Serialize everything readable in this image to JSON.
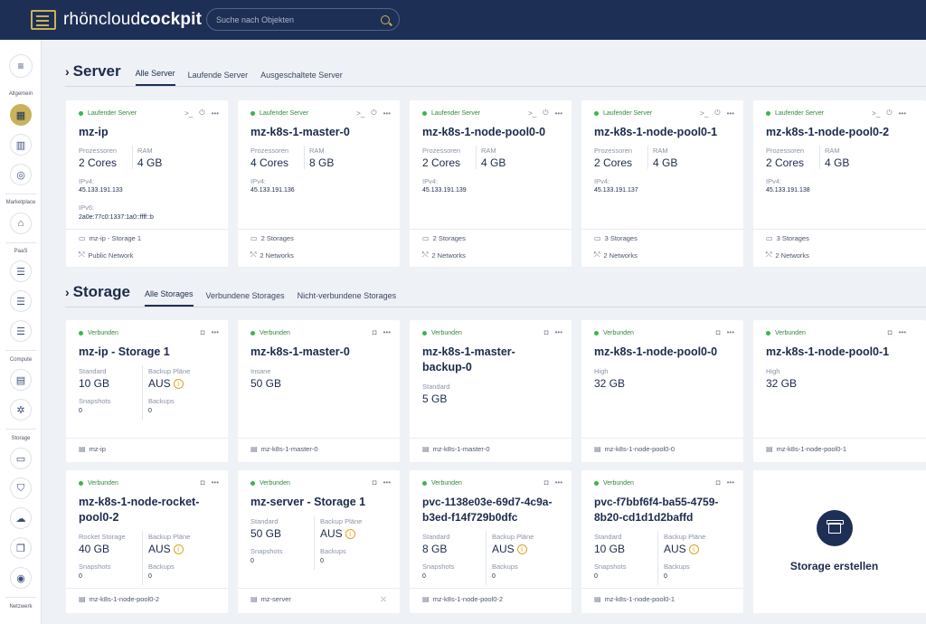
{
  "brand": {
    "name_light": "rhöncloud",
    "name_bold": "cockpit"
  },
  "search": {
    "placeholder": "Suche nach Objekten"
  },
  "sidebar": {
    "sections": [
      "Allgemein",
      "Marketplace",
      "PaaS",
      "Compute",
      "Storage",
      "Netzwerk"
    ],
    "icons": [
      "menu-icon",
      "dashboard-icon",
      "chart-icon",
      "location-icon",
      "marketplace-icon",
      "database-icon",
      "database-icon",
      "database-icon",
      "server-icon",
      "kubernetes-icon",
      "storage-icon",
      "shield-icon",
      "cloud-icon",
      "files-icon",
      "disk-icon"
    ]
  },
  "server_section": {
    "title": "Server",
    "tabs": [
      "Alle Server",
      "Laufende Server",
      "Ausgeschaltete Server"
    ],
    "active_tab": 0,
    "labels": {
      "cpu": "Prozessoren",
      "ram": "RAM",
      "ipv4": "IPv4:",
      "ipv6": "IPv6:"
    },
    "cards": [
      {
        "status": "Laufender Server",
        "name": "mz-ip",
        "cpu": "2 Cores",
        "ram": "4 GB",
        "ipv4": "45.133.191.133",
        "ipv6": "2a0e:77c0:1337:1a0::ffff::b",
        "storage": "mz-ip - Storage 1",
        "network": "Public Network"
      },
      {
        "status": "Laufender Server",
        "name": "mz-k8s-1-master-0",
        "cpu": "4 Cores",
        "ram": "8 GB",
        "ipv4": "45.133.191.136",
        "storage": "2 Storages",
        "network": "2 Networks"
      },
      {
        "status": "Laufender Server",
        "name": "mz-k8s-1-node-pool0-0",
        "cpu": "2 Cores",
        "ram": "4 GB",
        "ipv4": "45.133.191.139",
        "storage": "2 Storages",
        "network": "2 Networks"
      },
      {
        "status": "Laufender Server",
        "name": "mz-k8s-1-node-pool0-1",
        "cpu": "2 Cores",
        "ram": "4 GB",
        "ipv4": "45.133.191.137",
        "storage": "3 Storages",
        "network": "2 Networks"
      },
      {
        "status": "Laufender Server",
        "name": "mz-k8s-1-node-pool0-2",
        "cpu": "2 Cores",
        "ram": "4 GB",
        "ipv4": "45.133.191.138",
        "storage": "3 Storages",
        "network": "2 Networks"
      }
    ]
  },
  "storage_section": {
    "title": "Storage",
    "tabs": [
      "Alle Storages",
      "Verbundene Storages",
      "Nicht-verbundene Storages"
    ],
    "active_tab": 0,
    "labels": {
      "backup": "Backup Pläne",
      "snapshots": "Snapshots",
      "backups": "Backups"
    },
    "cards": [
      {
        "status": "Verbunden",
        "name": "mz-ip - Storage 1",
        "type": "Standard",
        "size": "10 GB",
        "backup_plan": "AUS",
        "snapshots": "0",
        "backups": "0",
        "server": "mz-ip"
      },
      {
        "status": "Verbunden",
        "name": "mz-k8s-1-master-0",
        "type": "Insane",
        "size": "50 GB",
        "server": "mz-k8s-1-master-0"
      },
      {
        "status": "Verbunden",
        "name": "mz-k8s-1-master-backup-0",
        "type": "Standard",
        "size": "5 GB",
        "server": "mz-k8s-1-master-0"
      },
      {
        "status": "Verbunden",
        "name": "mz-k8s-1-node-pool0-0",
        "type": "High",
        "size": "32 GB",
        "server": "mz-k8s-1-node-pool0-0"
      },
      {
        "status": "Verbunden",
        "name": "mz-k8s-1-node-pool0-1",
        "type": "High",
        "size": "32 GB",
        "server": "mz-k8s-1-node-pool0-1"
      },
      {
        "status": "Verbunden",
        "name": "mz-k8s-1-node-rocket-pool0-2",
        "type": "Rocket Storage",
        "size": "40 GB",
        "backup_plan": "AUS",
        "snapshots": "0",
        "backups": "0",
        "server": "mz-k8s-1-node-pool0-2"
      },
      {
        "status": "Verbunden",
        "name": "mz-server - Storage 1",
        "type": "Standard",
        "size": "50 GB",
        "backup_plan": "AUS",
        "snapshots": "0",
        "backups": "0",
        "server": "mz-server"
      },
      {
        "status": "Verbunden",
        "name": "pvc-1138e03e-69d7-4c9a-b3ed-f14f729b0dfc",
        "type": "Standard",
        "size": "8 GB",
        "backup_plan": "AUS",
        "snapshots": "0",
        "backups": "0",
        "server": "mz-k8s-1-node-pool0-2"
      },
      {
        "status": "Verbunden",
        "name": "pvc-f7bbf6f4-ba55-4759-8b20-cd1d1d2baffd",
        "type": "Standard",
        "size": "10 GB",
        "backup_plan": "AUS",
        "snapshots": "0",
        "backups": "0",
        "server": "mz-k8s-1-node-pool0-1"
      }
    ],
    "create_label": "Storage erstellen"
  }
}
